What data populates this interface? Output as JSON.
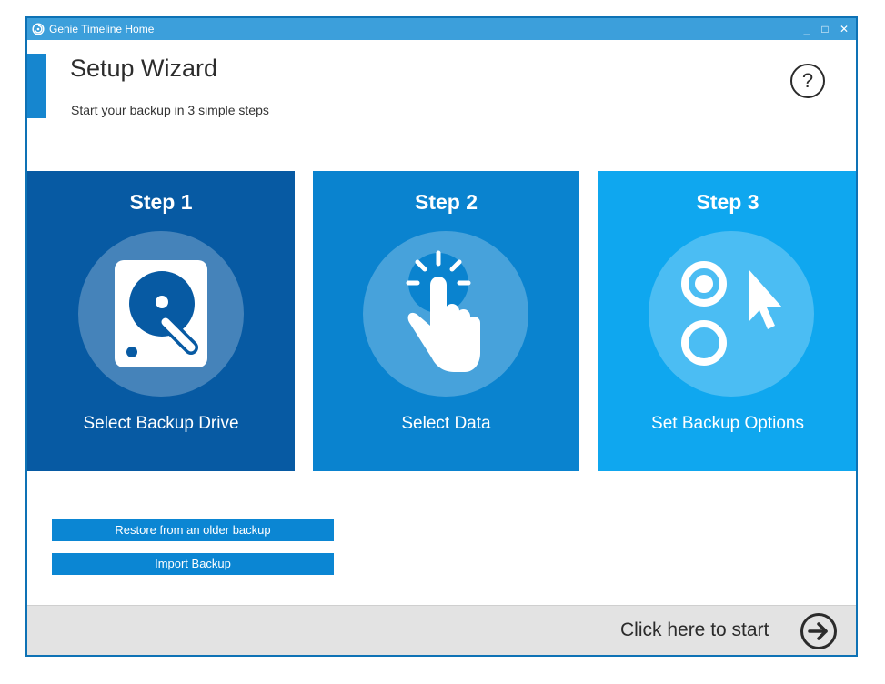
{
  "window": {
    "title": "Genie Timeline Home",
    "minimize_label": "_",
    "maximize_label": "□",
    "close_label": "✕"
  },
  "header": {
    "title": "Setup Wizard",
    "subtitle": "Start your backup in 3 simple steps",
    "help_label": "?"
  },
  "steps": [
    {
      "title": "Step 1",
      "label": "Select Backup Drive",
      "icon": "hard-drive-icon",
      "color": "#075aa3"
    },
    {
      "title": "Step 2",
      "label": "Select Data",
      "icon": "tap-hand-icon",
      "color": "#0a83cf"
    },
    {
      "title": "Step 3",
      "label": "Set Backup Options",
      "icon": "options-cursor-icon",
      "color": "#0fa7ef"
    }
  ],
  "actions": {
    "restore_label": "Restore from an older backup",
    "import_label": "Import Backup"
  },
  "footer": {
    "start_label": "Click here to start",
    "icon": "arrow-circle-right-icon"
  },
  "colors": {
    "accent": "#1686cf",
    "titlebar": "#3c9fdb",
    "button": "#0b86d3",
    "footer_bg": "#e3e3e3"
  }
}
